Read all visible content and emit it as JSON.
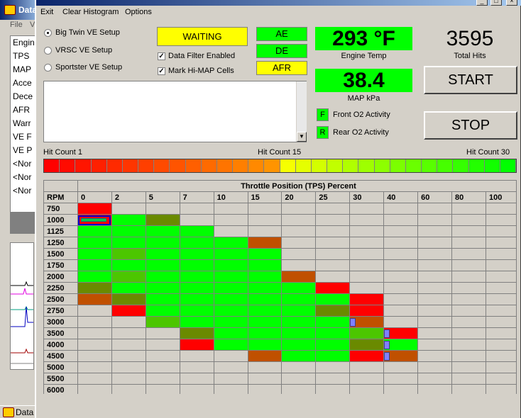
{
  "colors": {
    "green": "#00ff00",
    "red": "#ff0000",
    "yellow": "#ffff00",
    "olive": "#6a8a00",
    "brown": "#c05000",
    "midgreen": "#4cc600"
  },
  "background": {
    "title": "Data",
    "menu_visible": "File",
    "menu_initial": "V",
    "list_items": [
      "Engin",
      "TPS",
      "MAP",
      "Acce",
      "Dece",
      "AFR",
      "Warr",
      "VE F",
      "VE P",
      "<Nor",
      "<Nor",
      "<Nor"
    ],
    "taskbar": "Data"
  },
  "menu": [
    "Exit",
    "Clear Histogram",
    "Options"
  ],
  "setup": {
    "options": [
      "Big Twin VE Setup",
      "VRSC VE Setup",
      "Sportster VE Setup"
    ],
    "selected": 0
  },
  "status": {
    "state": "WAITING",
    "checks": [
      {
        "label": "Data Filter Enabled",
        "checked": true
      },
      {
        "label": "Mark Hi-MAP Cells",
        "checked": true
      }
    ],
    "ae": "AE",
    "de": "DE",
    "afr": "AFR"
  },
  "gauges": {
    "engine_temp": "293 °F",
    "engine_temp_label": "Engine Temp",
    "total_hits": "3595",
    "total_hits_label": "Total Hits",
    "map": "38.4",
    "map_label": "MAP kPa"
  },
  "o2": {
    "front_letter": "F",
    "front_label": "Front O2 Activity",
    "rear_letter": "R",
    "rear_label": "Rear O2 Activity"
  },
  "buttons": {
    "start": "START",
    "stop": "STOP"
  },
  "hitcount": {
    "low": "Hit Count 1",
    "mid": "Hit Count 15",
    "high": "Hit Count 30"
  },
  "histogram": {
    "title": "Throttle Position (TPS) Percent",
    "rpm_label": "RPM",
    "tps": [
      "0",
      "2",
      "5",
      "7",
      "10",
      "15",
      "20",
      "25",
      "30",
      "40",
      "60",
      "80",
      "100"
    ],
    "rows": [
      {
        "rpm": "750",
        "cells": [
          "r",
          "",
          "",
          "",
          "",
          "",
          "",
          "",
          "",
          "",
          "",
          "",
          ""
        ]
      },
      {
        "rpm": "1000",
        "cells": [
          "sel",
          "g",
          "o",
          "",
          "",
          "",
          "",
          "",
          "",
          "",
          "",
          "",
          ""
        ]
      },
      {
        "rpm": "1125",
        "cells": [
          "g",
          "g",
          "g",
          "g",
          "",
          "",
          "",
          "",
          "",
          "",
          "",
          "",
          ""
        ]
      },
      {
        "rpm": "1250",
        "cells": [
          "g",
          "g",
          "g",
          "g",
          "g",
          "b",
          "",
          "",
          "",
          "",
          "",
          "",
          ""
        ]
      },
      {
        "rpm": "1500",
        "cells": [
          "g",
          "m",
          "g",
          "g",
          "g",
          "g",
          "",
          "",
          "",
          "",
          "",
          "",
          ""
        ]
      },
      {
        "rpm": "1750",
        "cells": [
          "g",
          "g",
          "g",
          "g",
          "g",
          "g",
          "",
          "",
          "",
          "",
          "",
          "",
          ""
        ]
      },
      {
        "rpm": "2000",
        "cells": [
          "g",
          "m",
          "g",
          "g",
          "g",
          "g",
          "b",
          "",
          "",
          "",
          "",
          "",
          ""
        ]
      },
      {
        "rpm": "2250",
        "cells": [
          "o",
          "g",
          "g",
          "g",
          "g",
          "g",
          "g",
          "r",
          "",
          "",
          "",
          "",
          ""
        ]
      },
      {
        "rpm": "2500",
        "cells": [
          "b",
          "o",
          "g",
          "g",
          "g",
          "g",
          "g",
          "g",
          "r",
          "",
          "",
          "",
          ""
        ]
      },
      {
        "rpm": "2750",
        "cells": [
          "",
          "r",
          "g",
          "g",
          "g",
          "g",
          "g",
          "o",
          "r",
          "",
          "",
          "",
          ""
        ]
      },
      {
        "rpm": "3000",
        "cells": [
          "",
          "",
          "m",
          "g",
          "g",
          "g",
          "g",
          "g",
          "pb",
          "",
          "",
          "",
          ""
        ]
      },
      {
        "rpm": "3500",
        "cells": [
          "",
          "",
          "",
          "o",
          "g",
          "g",
          "g",
          "g",
          "m",
          "pr",
          "",
          "",
          ""
        ]
      },
      {
        "rpm": "4000",
        "cells": [
          "",
          "",
          "",
          "r",
          "g",
          "g",
          "g",
          "g",
          "o",
          "pg",
          "",
          "",
          ""
        ]
      },
      {
        "rpm": "4500",
        "cells": [
          "",
          "",
          "",
          "",
          "",
          "b",
          "g",
          "g",
          "r",
          "pb",
          "",
          "",
          ""
        ]
      },
      {
        "rpm": "5000",
        "cells": [
          "",
          "",
          "",
          "",
          "",
          "",
          "",
          "",
          "",
          "",
          "",
          "",
          ""
        ]
      },
      {
        "rpm": "5500",
        "cells": [
          "",
          "",
          "",
          "",
          "",
          "",
          "",
          "",
          "",
          "",
          "",
          "",
          ""
        ]
      },
      {
        "rpm": "6000",
        "cells": [
          "",
          "",
          "",
          "",
          "",
          "",
          "",
          "",
          "",
          "",
          "",
          "",
          ""
        ]
      }
    ]
  }
}
